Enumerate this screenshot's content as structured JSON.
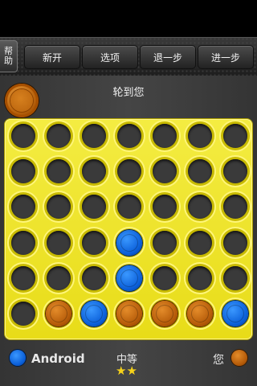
{
  "toolbar": {
    "help_label": "帮助",
    "buttons": [
      {
        "label": "新开"
      },
      {
        "label": "选项"
      },
      {
        "label": "退一步"
      },
      {
        "label": "进一步"
      }
    ]
  },
  "status": {
    "turn_text": "轮到您",
    "turn_color": "orange"
  },
  "board": {
    "columns": 7,
    "rows": 6,
    "grid": [
      [
        "",
        "",
        "",
        "",
        "",
        "",
        ""
      ],
      [
        "",
        "",
        "",
        "",
        "",
        "",
        ""
      ],
      [
        "",
        "",
        "",
        "",
        "",
        "",
        ""
      ],
      [
        "",
        "",
        "",
        "B",
        "",
        "",
        ""
      ],
      [
        "",
        "",
        "",
        "B",
        "",
        "",
        ""
      ],
      [
        "",
        "O",
        "B",
        "O",
        "O",
        "O",
        "B"
      ]
    ]
  },
  "footer": {
    "player1_name": "Android",
    "player1_color": "blue",
    "difficulty_label": "中等",
    "difficulty_stars": "★★",
    "player2_name": "您",
    "player2_color": "orange"
  },
  "colors": {
    "board": "#f0e42c",
    "orange_piece": "#c96a10",
    "blue_piece": "#1670e8",
    "star": "#f6d21a"
  }
}
